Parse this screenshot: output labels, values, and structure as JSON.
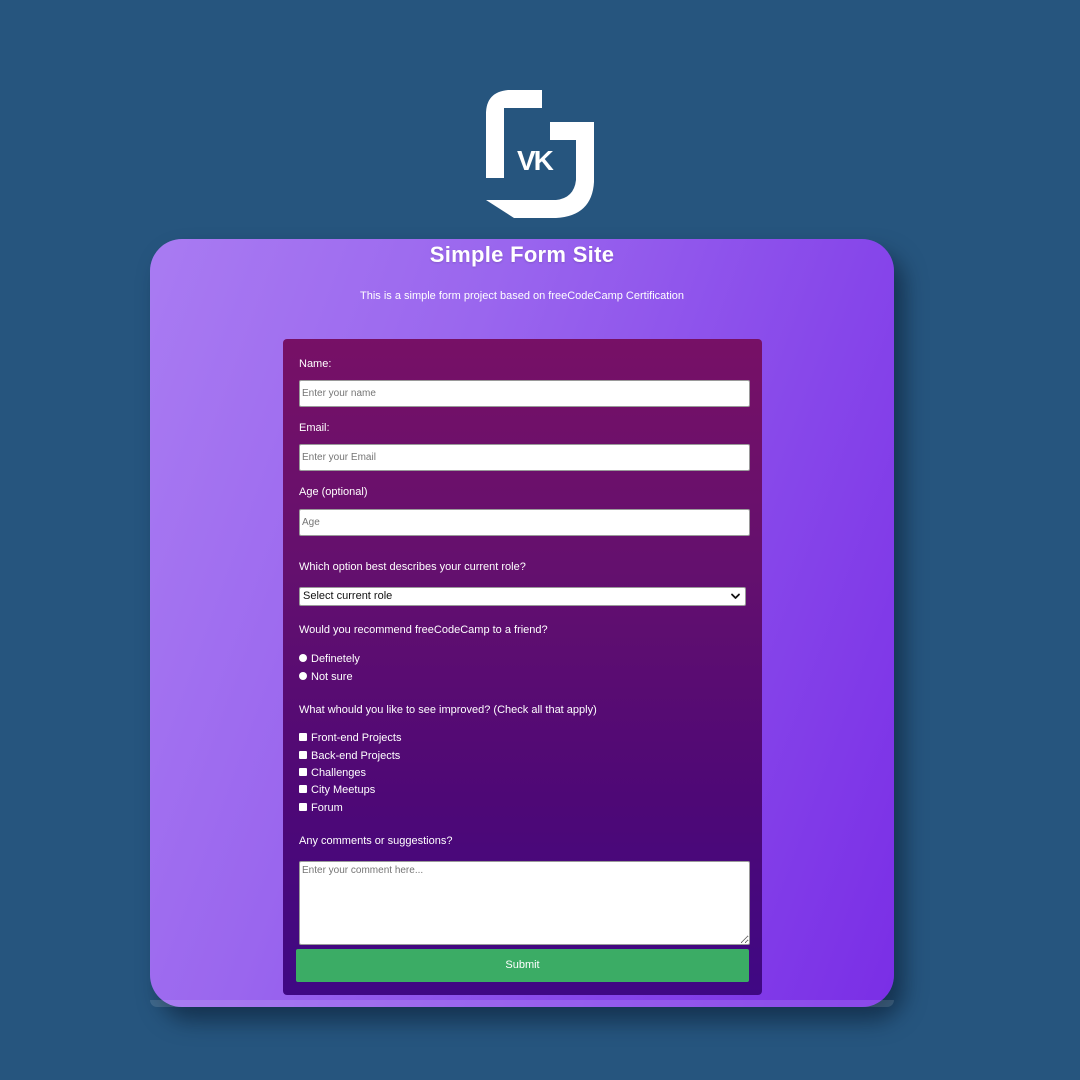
{
  "logo": {
    "text": "VK",
    "icon": "vk-logo-icon"
  },
  "header": {
    "title": "Simple Form Site",
    "subtitle": "This is a simple form project based on freeCodeCamp Certification"
  },
  "form": {
    "name": {
      "label": "Name:",
      "placeholder": "Enter your name",
      "value": ""
    },
    "email": {
      "label": "Email:",
      "placeholder": "Enter your Email",
      "value": ""
    },
    "age": {
      "label": "Age (optional)",
      "placeholder": "Age",
      "value": ""
    },
    "role": {
      "label": "Which option best describes your current role?",
      "selected": "Select current role",
      "icon": "chevron-down-icon"
    },
    "recommend": {
      "label": "Would you recommend freeCodeCamp to a friend?",
      "options": [
        "Definetely",
        "Not sure"
      ]
    },
    "improve": {
      "label": "What whould you like to see improved? (Check all that apply)",
      "options": [
        "Front-end Projects",
        "Back-end Projects",
        "Challenges",
        "City Meetups",
        "Forum"
      ]
    },
    "comments": {
      "label": "Any comments or suggestions?",
      "placeholder": "Enter your comment here...",
      "value": ""
    },
    "submit_label": "Submit"
  },
  "colors": {
    "page_background": "#26557e",
    "card_gradient_start": "#a97bf2",
    "card_gradient_end": "#7a2ee6",
    "panel_gradient_top": "#771066",
    "panel_gradient_bottom": "#3f0884",
    "submit": "#3bac65"
  }
}
